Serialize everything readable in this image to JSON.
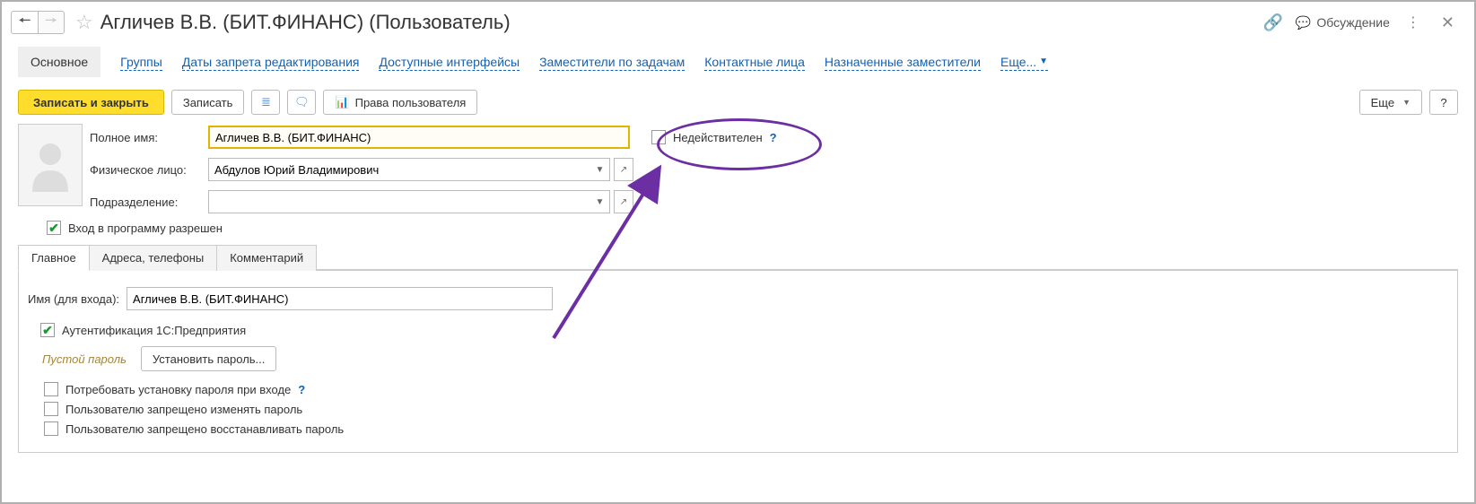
{
  "header": {
    "title": "Агличев В.В. (БИТ.ФИНАНС) (Пользователь)",
    "discuss": "Обсуждение"
  },
  "navtabs": {
    "main": "Основное",
    "groups": "Группы",
    "edit_lock_dates": "Даты запрета редактирования",
    "interfaces": "Доступные интерфейсы",
    "task_subs": "Заместители по задачам",
    "contacts": "Контактные лица",
    "assigned_subs": "Назначенные заместители",
    "more": "Еще..."
  },
  "toolbar": {
    "save_close": "Записать и закрыть",
    "save": "Записать",
    "user_rights": "Права пользователя",
    "more": "Еще",
    "help": "?"
  },
  "form": {
    "full_name_label": "Полное имя:",
    "full_name_value": "Агличев В.В. (БИТ.ФИНАНС)",
    "inactive_label": "Недействителен",
    "inactive_help": "?",
    "person_label": "Физическое лицо:",
    "person_value": "Абдулов Юрий Владимирович",
    "dept_label": "Подразделение:",
    "dept_value": "",
    "login_allowed": "Вход в программу разрешен"
  },
  "subtabs": {
    "main": "Главное",
    "addresses": "Адреса, телефоны",
    "comment": "Комментарий"
  },
  "login": {
    "login_label": "Имя (для входа):",
    "login_value": "Агличев В.В. (БИТ.ФИНАНС)",
    "auth_1c": "Аутентификация 1С:Предприятия",
    "empty_pass": "Пустой пароль",
    "set_pass_btn": "Установить пароль...",
    "require_pass_on_login": "Потребовать установку пароля при входе",
    "require_pass_help": "?",
    "deny_change_pass": "Пользователю запрещено изменять пароль",
    "deny_restore_pass": "Пользователю запрещено восстанавливать пароль"
  }
}
